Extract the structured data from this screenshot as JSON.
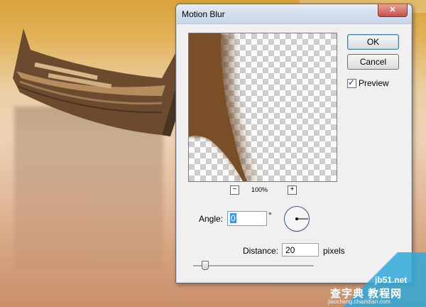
{
  "dialog": {
    "title": "Motion Blur",
    "ok_label": "OK",
    "cancel_label": "Cancel",
    "preview_label": "Preview",
    "preview_checked": true,
    "zoom": {
      "minus": "−",
      "plus": "+",
      "level": "100%"
    },
    "angle": {
      "label": "Angle:",
      "value": "0",
      "unit": "°"
    },
    "distance": {
      "label": "Distance:",
      "value": "20",
      "unit": "pixels",
      "slider_fraction": 0.08
    }
  },
  "watermark": {
    "site": "jb51.net",
    "name": "查字典 教程网",
    "url": "jiaocheng.chazidian.com",
    "color": "#2fa8d8"
  },
  "colors": {
    "dialog_bg": "#f0f0f0",
    "title_gradient": "#d3dfee",
    "default_button_border": "#3c7fb1",
    "selection": "#3399ff"
  }
}
